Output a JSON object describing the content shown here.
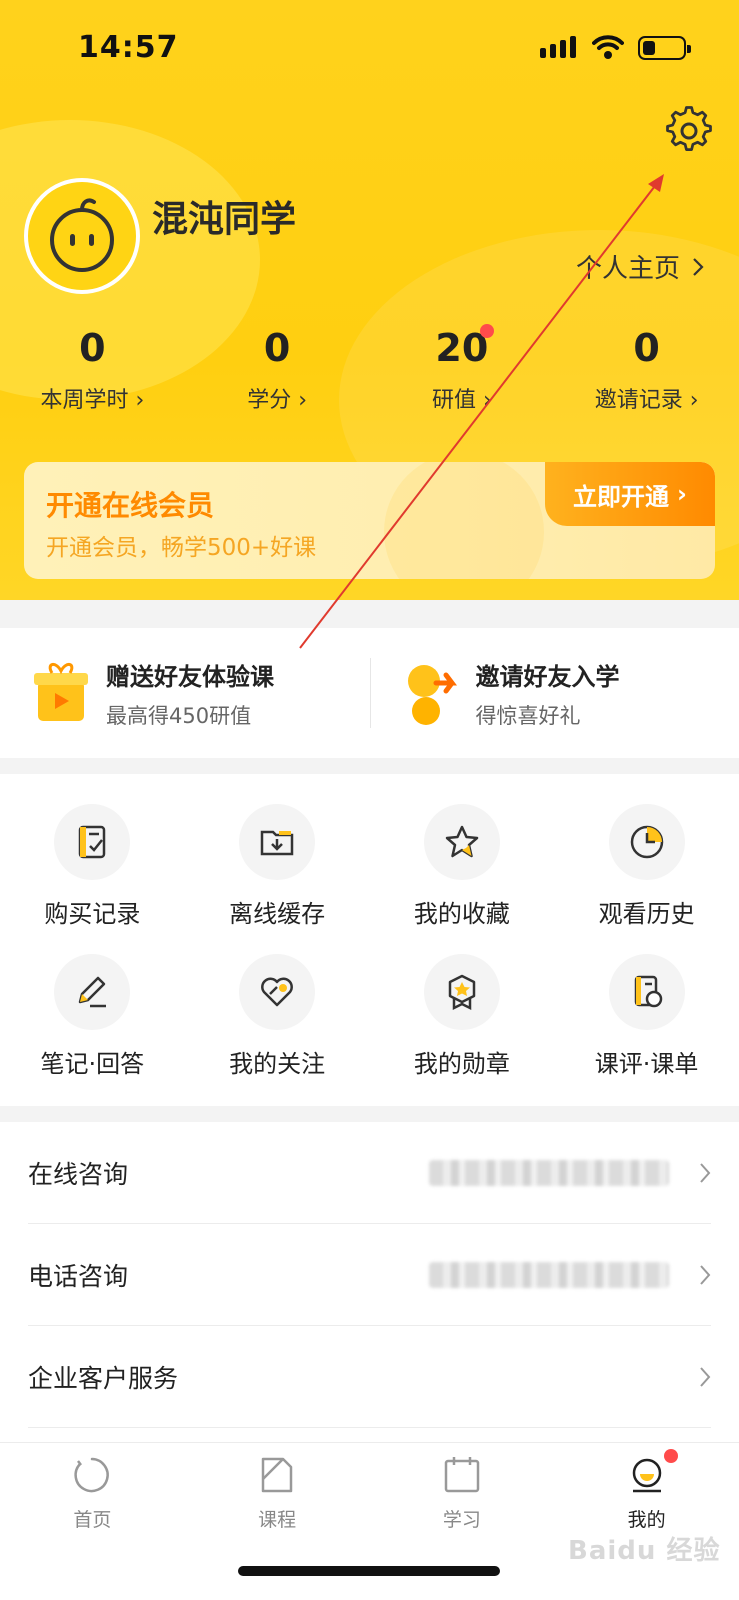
{
  "status_bar": {
    "time": "14:57"
  },
  "profile": {
    "username": "混沌同学",
    "profile_link": "个人主页"
  },
  "stats": [
    {
      "value": "0",
      "label": "本周学时"
    },
    {
      "value": "0",
      "label": "学分"
    },
    {
      "value": "20",
      "label": "研值"
    },
    {
      "value": "0",
      "label": "邀请记录"
    }
  ],
  "vip": {
    "title": "开通在线会员",
    "subtitle": "开通会员，畅学500+好课",
    "button": "立即开通"
  },
  "promo": [
    {
      "title": "赠送好友体验课",
      "subtitle": "最高得450研值"
    },
    {
      "title": "邀请好友入学",
      "subtitle": "得惊喜好礼"
    }
  ],
  "grid": [
    {
      "label": "购买记录",
      "icon": "purchase-record-icon"
    },
    {
      "label": "离线缓存",
      "icon": "offline-cache-icon"
    },
    {
      "label": "我的收藏",
      "icon": "star-icon"
    },
    {
      "label": "观看历史",
      "icon": "clock-icon"
    },
    {
      "label": "笔记·回答",
      "icon": "pencil-icon"
    },
    {
      "label": "我的关注",
      "icon": "heart-icon"
    },
    {
      "label": "我的勋章",
      "icon": "medal-icon"
    },
    {
      "label": "课评·课单",
      "icon": "review-icon"
    }
  ],
  "list": [
    {
      "label": "在线咨询"
    },
    {
      "label": "电话咨询"
    },
    {
      "label": "企业客户服务"
    }
  ],
  "tabs": [
    {
      "label": "首页",
      "icon": "home-icon"
    },
    {
      "label": "课程",
      "icon": "course-icon"
    },
    {
      "label": "学习",
      "icon": "calendar-icon"
    },
    {
      "label": "我的",
      "icon": "profile-icon"
    }
  ],
  "watermark": "Baidu 经验",
  "colors": {
    "brand_yellow": "#ffd21c",
    "accent_orange": "#ff8a00",
    "badge_red": "#ff4b4b"
  }
}
